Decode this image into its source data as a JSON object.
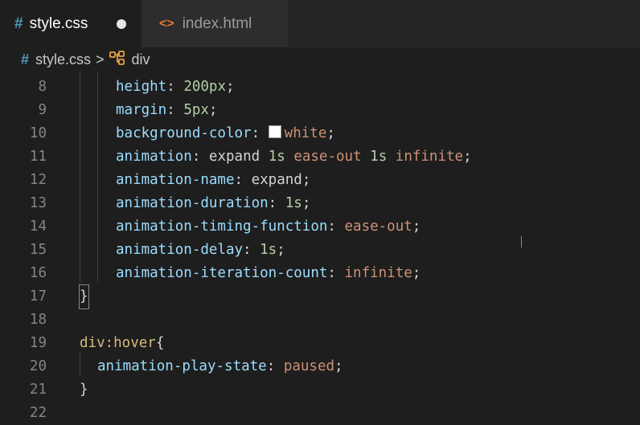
{
  "tabs": [
    {
      "icon": "#",
      "label": "style.css",
      "active": true,
      "modified": true
    },
    {
      "icon": "<>",
      "label": "index.html",
      "active": false
    }
  ],
  "breadcrumb": {
    "file_icon": "#",
    "file": "style.css",
    "separator": ">",
    "symbol_icon": "symbol-class",
    "symbol": "div"
  },
  "editor": {
    "lines": [
      {
        "number": "8",
        "prop": "height",
        "colon": ":",
        "value": "200px",
        "end": ";"
      },
      {
        "number": "9",
        "prop": "margin",
        "colon": ":",
        "value": "5px",
        "end": ";"
      },
      {
        "number": "10",
        "prop": "background-color",
        "colon": ":",
        "value": "white",
        "end": ";"
      },
      {
        "number": "11",
        "prop": "animation",
        "colon": ":",
        "v1": "expand",
        "v2": "1s",
        "v3": "ease-out",
        "v4": "1s",
        "v5": "infinite",
        "end": ";"
      },
      {
        "number": "12",
        "prop": "animation-name",
        "colon": ":",
        "value": "expand",
        "end": ";"
      },
      {
        "number": "13",
        "prop": "animation-duration",
        "colon": ":",
        "value": "1s",
        "end": ";"
      },
      {
        "number": "14",
        "prop": "animation-timing-function",
        "colon": ":",
        "value": "ease-out",
        "end": ";"
      },
      {
        "number": "15",
        "prop": "animation-delay",
        "colon": ":",
        "value": "1s",
        "end": ";"
      },
      {
        "number": "16",
        "prop": "animation-iteration-count",
        "colon": ":",
        "value": "infinite",
        "end": ";"
      },
      {
        "number": "17",
        "text": "}"
      },
      {
        "number": "18",
        "text": ""
      },
      {
        "number": "19",
        "selector": "div:hover",
        "brace": "{"
      },
      {
        "number": "20",
        "prop": "animation-play-state",
        "colon": ":",
        "value": "paused",
        "end": ";"
      },
      {
        "number": "21",
        "text": "}"
      },
      {
        "number": "22",
        "text": ""
      }
    ]
  },
  "colors": {
    "editor_bg": "#1e1e1e",
    "property": "#9cdcfe",
    "number": "#b5cea8",
    "string_value": "#ce9178",
    "selector": "#d7ba7d",
    "css_icon": "#519aba",
    "html_icon": "#e37933"
  }
}
